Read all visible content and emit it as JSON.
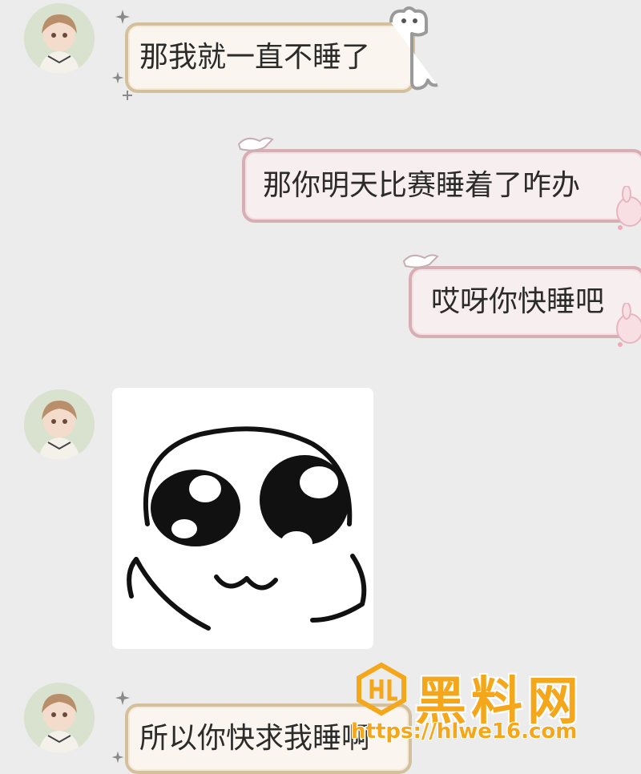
{
  "messages": [
    {
      "side": "left",
      "text": "那我就一直不睡了"
    },
    {
      "side": "right",
      "text": "那你明天比赛睡着了咋办"
    },
    {
      "side": "right",
      "text": "哎呀你快睡吧"
    },
    {
      "side": "left",
      "type": "sticker",
      "sticker": "crying-face-sticker"
    },
    {
      "side": "left",
      "text": "所以你快求我睡啊"
    }
  ],
  "watermark": {
    "title": "黑料网",
    "url": "https://hlwe16.com",
    "accent": "#f4a71b"
  },
  "colors": {
    "background": "#ececec",
    "left_bubble_border": "#d4c09c",
    "right_bubble_border": "#d8aeb5"
  }
}
